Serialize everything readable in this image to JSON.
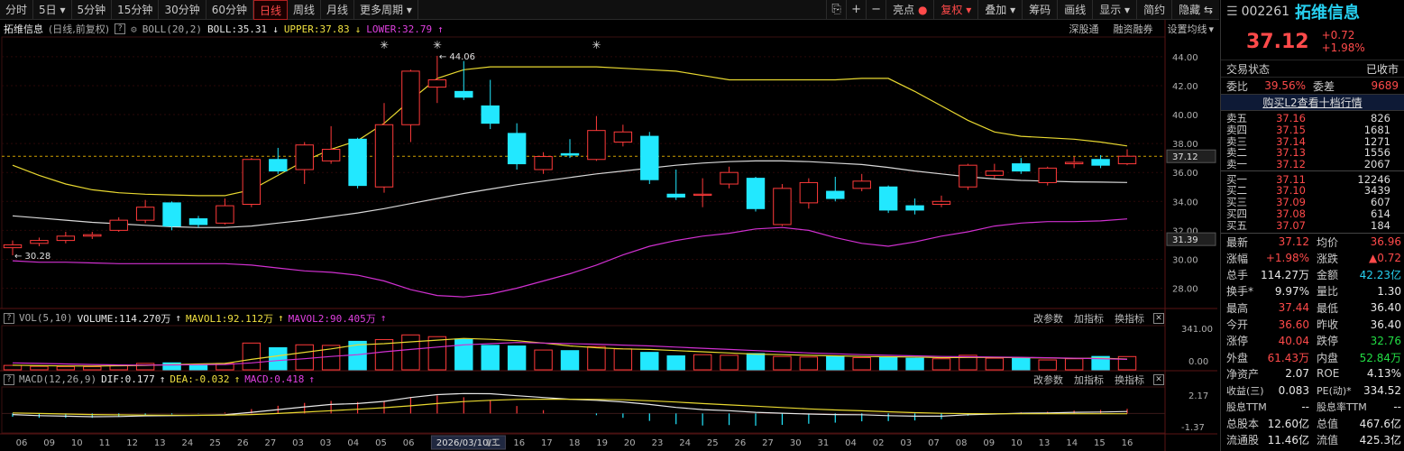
{
  "toolbar": {
    "periods": [
      "分时",
      "5日",
      "5分钟",
      "15分钟",
      "30分钟",
      "60分钟",
      "日线",
      "周线",
      "月线",
      "更多周期"
    ],
    "active_index": 6,
    "icons": [
      "⎘",
      "+",
      "−"
    ],
    "right_buttons": [
      "亮点",
      "复权",
      "叠加",
      "筹码",
      "画线",
      "显示",
      "简约",
      "隐藏"
    ],
    "red_index": 1
  },
  "kline_info": {
    "stock": "拓维信息",
    "mode": "(日线,前复权)",
    "boll_params": "BOLL(20,2)",
    "boll": "BOLL:35.31",
    "upper": "UPPER:37.83",
    "lower": "LOWER:32.79",
    "links": [
      "深股通",
      "融资融券",
      "设置均线"
    ]
  },
  "vol_info": {
    "params": "VOL(5,10)",
    "volume": "VOLUME:114.270万",
    "mavol1": "MAVOL1:92.112万",
    "mavol2": "MAVOL2:90.405万",
    "links": [
      "改参数",
      "加指标",
      "换指标"
    ]
  },
  "macd_info": {
    "params": "MACD(12,26,9)",
    "dif": "DIF:0.177",
    "dea": "DEA:-0.032",
    "macd": "MACD:0.418",
    "links": [
      "改参数",
      "加指标",
      "换指标"
    ]
  },
  "chart_data": {
    "type": "candlestick",
    "price_axis": {
      "ticks": [
        28.0,
        30.0,
        32.0,
        34.0,
        36.0,
        38.0,
        40.0,
        42.0,
        44.0
      ],
      "ylim": [
        26.6,
        45.3
      ],
      "current_label": "37.12",
      "extra_label": "31.39"
    },
    "vol_axis": {
      "ticks": [
        "341.00",
        "0.00"
      ],
      "max": 341
    },
    "macd_axis": {
      "ticks": [
        "2.17",
        "-1.37"
      ],
      "ylim": [
        -1.37,
        2.17
      ]
    },
    "annotations": {
      "high_label": "44.06",
      "low_label": "30.28"
    },
    "x_labels": [
      "06",
      "09",
      "10",
      "11",
      "12",
      "13",
      "24",
      "25",
      "26",
      "27",
      "03",
      "03",
      "04",
      "05",
      "06",
      "09",
      "2026/03/10/二",
      "13",
      "16",
      "17",
      "18",
      "19",
      "20",
      "23",
      "24",
      "25",
      "26",
      "27",
      "30",
      "31",
      "04",
      "02",
      "03",
      "07",
      "08",
      "09",
      "10",
      "13",
      "14",
      "15",
      "16"
    ],
    "candles": [
      {
        "o": 30.8,
        "c": 31.0,
        "h": 31.3,
        "l": 30.28
      },
      {
        "o": 31.1,
        "c": 31.3,
        "h": 31.5,
        "l": 30.9
      },
      {
        "o": 31.3,
        "c": 31.6,
        "h": 31.9,
        "l": 31.1
      },
      {
        "o": 31.6,
        "c": 31.7,
        "h": 31.9,
        "l": 31.4
      },
      {
        "o": 32.0,
        "c": 32.7,
        "h": 32.9,
        "l": 31.9
      },
      {
        "o": 32.7,
        "c": 33.6,
        "h": 34.1,
        "l": 32.5
      },
      {
        "o": 33.9,
        "c": 32.3,
        "h": 34.0,
        "l": 32.0
      },
      {
        "o": 32.8,
        "c": 32.4,
        "h": 33.0,
        "l": 32.2
      },
      {
        "o": 32.5,
        "c": 33.7,
        "h": 34.2,
        "l": 32.4
      },
      {
        "o": 33.8,
        "c": 36.9,
        "h": 37.0,
        "l": 33.6
      },
      {
        "o": 36.9,
        "c": 36.1,
        "h": 37.7,
        "l": 35.9
      },
      {
        "o": 36.2,
        "c": 37.9,
        "h": 38.1,
        "l": 35.2
      },
      {
        "o": 36.8,
        "c": 37.6,
        "h": 39.2,
        "l": 36.6
      },
      {
        "o": 38.3,
        "c": 35.1,
        "h": 38.4,
        "l": 34.9
      },
      {
        "o": 35.0,
        "c": 39.3,
        "h": 40.8,
        "l": 34.6
      },
      {
        "o": 39.3,
        "c": 43.0,
        "h": 43.1,
        "l": 38.1
      },
      {
        "o": 41.9,
        "c": 42.4,
        "h": 44.06,
        "l": 40.8
      },
      {
        "o": 41.6,
        "c": 41.2,
        "h": 43.7,
        "l": 41.0
      },
      {
        "o": 40.6,
        "c": 39.4,
        "h": 42.4,
        "l": 39.0
      },
      {
        "o": 38.7,
        "c": 36.6,
        "h": 39.4,
        "l": 36.2
      },
      {
        "o": 36.2,
        "c": 37.1,
        "h": 37.4,
        "l": 35.9
      },
      {
        "o": 37.3,
        "c": 37.2,
        "h": 38.3,
        "l": 37.0
      },
      {
        "o": 36.9,
        "c": 38.9,
        "h": 39.9,
        "l": 36.8
      },
      {
        "o": 38.1,
        "c": 38.8,
        "h": 39.3,
        "l": 37.8
      },
      {
        "o": 38.5,
        "c": 35.5,
        "h": 38.8,
        "l": 35.2
      },
      {
        "o": 34.5,
        "c": 34.3,
        "h": 36.2,
        "l": 34.1
      },
      {
        "o": 34.5,
        "c": 34.5,
        "h": 35.6,
        "l": 33.6
      },
      {
        "o": 35.2,
        "c": 36.0,
        "h": 36.4,
        "l": 34.9
      },
      {
        "o": 35.6,
        "c": 33.5,
        "h": 35.7,
        "l": 33.3
      },
      {
        "o": 32.4,
        "c": 34.9,
        "h": 35.2,
        "l": 32.3
      },
      {
        "o": 33.9,
        "c": 35.3,
        "h": 35.6,
        "l": 33.5
      },
      {
        "o": 34.7,
        "c": 34.2,
        "h": 35.7,
        "l": 34.0
      },
      {
        "o": 34.9,
        "c": 35.4,
        "h": 35.9,
        "l": 34.7
      },
      {
        "o": 35.0,
        "c": 33.4,
        "h": 35.1,
        "l": 33.2
      },
      {
        "o": 33.7,
        "c": 33.4,
        "h": 34.2,
        "l": 33.1
      },
      {
        "o": 33.8,
        "c": 34.0,
        "h": 34.4,
        "l": 33.6
      },
      {
        "o": 35.0,
        "c": 36.5,
        "h": 36.6,
        "l": 34.8
      },
      {
        "o": 35.8,
        "c": 36.1,
        "h": 36.6,
        "l": 35.6
      },
      {
        "o": 36.6,
        "c": 36.1,
        "h": 37.0,
        "l": 35.9
      },
      {
        "o": 35.3,
        "c": 36.3,
        "h": 36.4,
        "l": 35.1
      },
      {
        "o": 36.6,
        "c": 36.7,
        "h": 37.1,
        "l": 36.3
      },
      {
        "o": 36.9,
        "c": 36.5,
        "h": 37.2,
        "l": 36.3
      },
      {
        "o": 36.6,
        "c": 37.12,
        "h": 37.6,
        "l": 36.5
      }
    ],
    "boll_mid": [
      33.0,
      32.85,
      32.7,
      32.55,
      32.45,
      32.35,
      32.25,
      32.2,
      32.2,
      32.3,
      32.5,
      32.7,
      32.95,
      33.2,
      33.5,
      33.85,
      34.2,
      34.55,
      34.85,
      35.15,
      35.4,
      35.65,
      35.9,
      36.1,
      36.3,
      36.5,
      36.65,
      36.75,
      36.8,
      36.8,
      36.75,
      36.65,
      36.55,
      36.35,
      36.1,
      35.9,
      35.7,
      35.55,
      35.45,
      35.4,
      35.35,
      35.33,
      35.31
    ],
    "boll_upper": [
      36.5,
      35.8,
      35.2,
      34.8,
      34.6,
      34.5,
      34.45,
      34.4,
      34.4,
      34.8,
      35.8,
      36.8,
      37.6,
      38.2,
      39.4,
      41.0,
      42.5,
      43.1,
      43.3,
      43.3,
      43.3,
      43.3,
      43.3,
      43.2,
      43.1,
      43.0,
      42.7,
      42.4,
      42.4,
      42.4,
      42.4,
      42.4,
      42.5,
      42.5,
      41.6,
      40.6,
      39.6,
      38.8,
      38.5,
      38.4,
      38.3,
      38.1,
      37.83
    ],
    "boll_lower": [
      29.9,
      29.8,
      29.8,
      29.75,
      29.7,
      29.7,
      29.7,
      29.7,
      29.7,
      29.6,
      29.4,
      29.2,
      29.1,
      28.9,
      28.5,
      27.9,
      27.5,
      27.4,
      27.6,
      28.0,
      28.5,
      29.0,
      29.6,
      30.3,
      30.9,
      31.3,
      31.6,
      31.8,
      32.1,
      32.2,
      32.0,
      31.5,
      31.1,
      30.9,
      31.2,
      31.6,
      31.9,
      32.3,
      32.5,
      32.6,
      32.6,
      32.65,
      32.79
    ],
    "volumes": [
      38,
      30,
      28,
      27,
      40,
      55,
      60,
      42,
      55,
      230,
      190,
      215,
      210,
      245,
      260,
      300,
      285,
      265,
      210,
      205,
      170,
      165,
      200,
      180,
      150,
      120,
      130,
      125,
      140,
      115,
      110,
      120,
      105,
      110,
      100,
      95,
      125,
      100,
      105,
      85,
      95,
      115,
      114
    ],
    "mavol1": [
      40,
      36,
      33,
      32,
      35,
      38,
      45,
      50,
      55,
      90,
      120,
      150,
      180,
      215,
      225,
      240,
      255,
      270,
      262,
      250,
      230,
      205,
      190,
      180,
      175,
      165,
      155,
      145,
      135,
      130,
      125,
      120,
      115,
      112,
      110,
      105,
      106,
      106,
      105,
      102,
      98,
      100,
      92
    ],
    "mavol2": [
      60,
      55,
      50,
      46,
      42,
      40,
      42,
      44,
      46,
      60,
      80,
      95,
      115,
      130,
      155,
      175,
      195,
      215,
      225,
      235,
      230,
      225,
      220,
      212,
      205,
      195,
      185,
      175,
      165,
      155,
      145,
      138,
      130,
      125,
      120,
      115,
      112,
      110,
      108,
      104,
      100,
      95,
      90
    ],
    "dif": [
      -0.1,
      -0.2,
      -0.25,
      -0.3,
      -0.28,
      -0.22,
      -0.2,
      -0.18,
      -0.12,
      0.1,
      0.35,
      0.6,
      0.82,
      0.9,
      1.1,
      1.45,
      1.72,
      1.82,
      1.8,
      1.62,
      1.45,
      1.3,
      1.2,
      1.05,
      0.82,
      0.55,
      0.35,
      0.25,
      0.1,
      0.02,
      -0.05,
      -0.1,
      -0.12,
      -0.2,
      -0.25,
      -0.25,
      -0.12,
      -0.05,
      0.02,
      0.05,
      0.1,
      0.13,
      0.177
    ],
    "dea": [
      0.05,
      0.0,
      -0.05,
      -0.1,
      -0.13,
      -0.15,
      -0.16,
      -0.17,
      -0.16,
      -0.1,
      0.0,
      0.12,
      0.25,
      0.38,
      0.52,
      0.7,
      0.9,
      1.08,
      1.2,
      1.28,
      1.3,
      1.3,
      1.28,
      1.25,
      1.16,
      1.04,
      0.9,
      0.78,
      0.66,
      0.54,
      0.42,
      0.32,
      0.24,
      0.15,
      0.07,
      0.01,
      -0.02,
      -0.03,
      -0.03,
      -0.03,
      -0.03,
      -0.03,
      -0.032
    ],
    "macd": [
      -0.3,
      -0.4,
      -0.4,
      -0.4,
      -0.3,
      -0.14,
      -0.08,
      -0.02,
      0.08,
      0.4,
      0.7,
      0.96,
      1.14,
      1.04,
      1.16,
      1.5,
      1.64,
      1.48,
      1.2,
      0.68,
      0.3,
      0.0,
      -0.16,
      -0.4,
      -0.68,
      -0.98,
      -1.1,
      -1.06,
      -1.12,
      -1.04,
      -0.94,
      -0.84,
      -0.72,
      -0.7,
      -0.64,
      -0.52,
      -0.2,
      -0.04,
      0.1,
      0.16,
      0.26,
      0.32,
      0.418
    ]
  },
  "side": {
    "code": "002261",
    "name": "拓维信息",
    "price": "37.12",
    "change": "+0.72",
    "change_pct": "+1.98%",
    "status_label": "交易状态",
    "status_value": "已收市",
    "webi_label": "委比",
    "webi_value": "39.56%",
    "weicha_label": "委差",
    "weicha_value": "9689",
    "l2_link": "购买L2查看十档行情",
    "asks": [
      {
        "label": "卖五",
        "price": "37.16",
        "vol": "826"
      },
      {
        "label": "卖四",
        "price": "37.15",
        "vol": "1681"
      },
      {
        "label": "卖三",
        "price": "37.14",
        "vol": "1271"
      },
      {
        "label": "卖二",
        "price": "37.13",
        "vol": "1556"
      },
      {
        "label": "卖一",
        "price": "37.12",
        "vol": "2067"
      }
    ],
    "bids": [
      {
        "label": "买一",
        "price": "37.11",
        "vol": "12246"
      },
      {
        "label": "买二",
        "price": "37.10",
        "vol": "3439"
      },
      {
        "label": "买三",
        "price": "37.09",
        "vol": "607"
      },
      {
        "label": "买四",
        "price": "37.08",
        "vol": "614"
      },
      {
        "label": "买五",
        "price": "37.07",
        "vol": "184"
      }
    ],
    "stats": [
      {
        "k1": "最新",
        "v1": "37.12",
        "c1": "red",
        "k2": "均价",
        "v2": "36.96",
        "c2": "red"
      },
      {
        "k1": "涨幅",
        "v1": "+1.98%",
        "c1": "red",
        "k2": "涨跌",
        "v2": "▲0.72",
        "c2": "red"
      },
      {
        "k1": "总手",
        "v1": "114.27万",
        "c1": "white",
        "k2": "金额",
        "v2": "42.23亿",
        "c2": "cyan"
      },
      {
        "k1": "换手*",
        "v1": "9.97%",
        "c1": "white",
        "k2": "量比",
        "v2": "1.30",
        "c2": "white"
      },
      {
        "k1": "最高",
        "v1": "37.44",
        "c1": "red",
        "k2": "最低",
        "v2": "36.40",
        "c2": "white"
      },
      {
        "k1": "今开",
        "v1": "36.60",
        "c1": "red",
        "k2": "昨收",
        "v2": "36.40",
        "c2": "white"
      },
      {
        "k1": "涨停",
        "v1": "40.04",
        "c1": "red",
        "k2": "跌停",
        "v2": "32.76",
        "c2": "green"
      },
      {
        "k1": "外盘",
        "v1": "61.43万",
        "c1": "red",
        "k2": "内盘",
        "v2": "52.84万",
        "c2": "green"
      },
      {
        "k1": "净资产",
        "v1": "2.07",
        "c1": "white",
        "k2": "ROE",
        "v2": "4.13%",
        "c2": "white"
      },
      {
        "k1": "收益(三)",
        "v1": "0.083",
        "c1": "white",
        "k2": "PE(动)*",
        "v2": "334.52",
        "c2": "white"
      },
      {
        "k1": "股息TTM",
        "v1": "--",
        "c1": "white",
        "k2": "股息率TTM",
        "v2": "--",
        "c2": "white"
      },
      {
        "k1": "总股本",
        "v1": "12.60亿",
        "c1": "white",
        "k2": "总值",
        "v2": "467.6亿",
        "c2": "white"
      },
      {
        "k1": "流通股",
        "v1": "11.46亿",
        "c1": "white",
        "k2": "流值",
        "v2": "425.3亿",
        "c2": "white"
      }
    ]
  }
}
